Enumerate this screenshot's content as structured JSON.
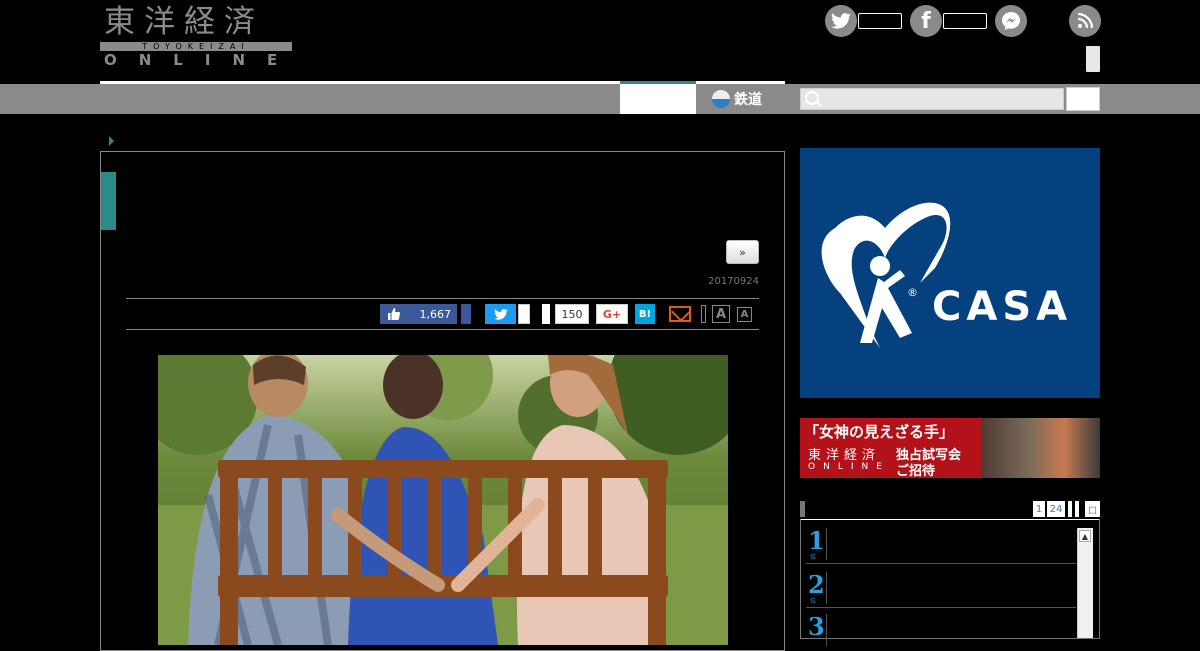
{
  "logo": {
    "jp": "東洋経済",
    "sub": "TOYOKEIZAI",
    "en": "ONLINE"
  },
  "social": {
    "twitter_icon": "twitter-icon",
    "facebook_icon": "facebook-icon",
    "messenger_icon": "messenger-icon",
    "rss_icon": "rss-icon"
  },
  "nav": {
    "rail_label": "鉄道"
  },
  "search": {
    "placeholder": ""
  },
  "article": {
    "next_label": "»",
    "date": "20170924",
    "likes": "1,667",
    "hatena_count": "150",
    "gplus_label": "G+",
    "hatena_label": "B!",
    "font_large": "A",
    "font_small": "A",
    "photo_alt": "couple on bench"
  },
  "ads": {
    "casa_text": "CASA",
    "casa_reg": "®",
    "movie_title": "「女神の見えざる手」",
    "movie_sub_jp": "東洋経済",
    "movie_sub_en": "ONLINE",
    "movie_right1": "独占試写会",
    "movie_right2": "ご招待"
  },
  "ranking": {
    "tab1": "1",
    "tab2": "24",
    "tab_last": "ロ",
    "items": [
      {
        "num": "1",
        "sub": "位"
      },
      {
        "num": "2",
        "sub": "位"
      },
      {
        "num": "3",
        "sub": ""
      }
    ]
  },
  "colors": {
    "accent": "#2a8a8c",
    "casa_blue": "#05407f",
    "movie_red": "#b4121a",
    "rank_blue": "#2aa0e0"
  }
}
